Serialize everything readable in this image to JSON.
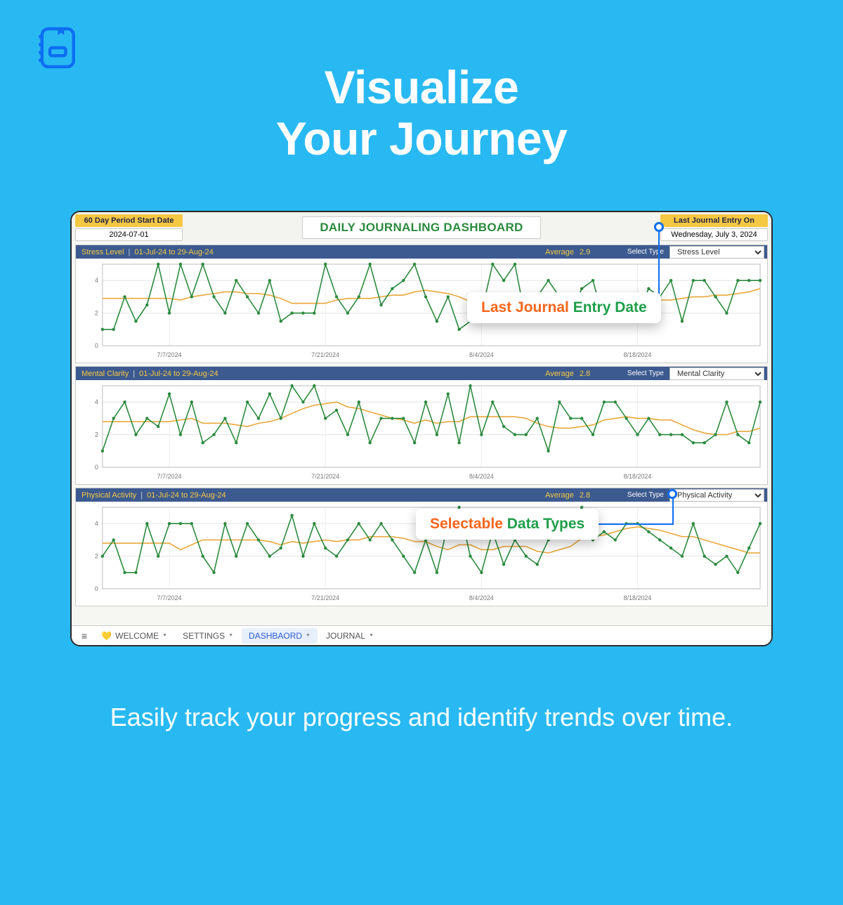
{
  "page": {
    "title_line1": "Visualize",
    "title_line2": "Your Journey",
    "subtitle": "Easily track your progress and identify trends over time."
  },
  "header": {
    "start_label": "60 Day Period Start Date",
    "start_value": "2024-07-01",
    "dash_title": "DAILY JOURNALING DASHBOARD",
    "last_label": "Last Journal Entry On",
    "last_value": "Wednesday, July 3, 2024"
  },
  "charts": [
    {
      "name": "Stress Level",
      "range": "01-Jul-24  to  29-Aug-24",
      "avg": "2.9",
      "type_selected": "Stress Level"
    },
    {
      "name": "Mental Clarity",
      "range": "01-Jul-24  to  29-Aug-24",
      "avg": "2.8",
      "type_selected": "Mental Clarity"
    },
    {
      "name": "Physical Activity",
      "range": "01-Jul-24  to  29-Aug-24",
      "avg": "2.8",
      "type_selected": "Physical Activity"
    }
  ],
  "common": {
    "avg_label": "Average",
    "select_label": "Select Type"
  },
  "x_ticks": [
    "7/7/2024",
    "7/21/2024",
    "8/4/2024",
    "8/18/2024"
  ],
  "y_ticks": [
    0,
    2,
    4
  ],
  "tabs": {
    "welcome": "WELCOME",
    "settings": "SETTINGS",
    "dashboard": "DASHBAORD",
    "journal": "JOURNAL"
  },
  "callouts": {
    "c1a": "Last Journal ",
    "c1b": "Entry Date",
    "c2a": "Selectable ",
    "c2b": "Data Types"
  },
  "chart_data": [
    {
      "type": "line",
      "title": "Stress Level  |  01-Jul-24 to 29-Aug-24   Average 2.9",
      "xlabel": "",
      "ylabel": "",
      "ylim": [
        0,
        5
      ],
      "x_tick_labels": [
        "7/7/2024",
        "7/21/2024",
        "8/4/2024",
        "8/18/2024"
      ],
      "series": [
        {
          "name": "Stress Level",
          "values": [
            1,
            1,
            3,
            1.5,
            2.5,
            5,
            2,
            5,
            3,
            5,
            3,
            2,
            4,
            3,
            2,
            4,
            1.5,
            2,
            2,
            2,
            5,
            3,
            2,
            3,
            5,
            2.5,
            3.5,
            4,
            5,
            3,
            1.5,
            3,
            1,
            1.5,
            2,
            5,
            4,
            5,
            1.5,
            3,
            4,
            3,
            2,
            3.5,
            4,
            1.5,
            2.5,
            3,
            2,
            3.5,
            3,
            4,
            1.5,
            4,
            4,
            3,
            2,
            4,
            4,
            4
          ]
        },
        {
          "name": "7-day Avg",
          "values": [
            2.9,
            2.9,
            2.9,
            2.9,
            2.9,
            2.9,
            2.9,
            2.8,
            3.0,
            3.1,
            3.2,
            3.3,
            3.3,
            3.2,
            3.2,
            3.1,
            2.9,
            2.6,
            2.6,
            2.6,
            2.6,
            2.8,
            2.9,
            2.9,
            2.9,
            3.0,
            3.1,
            3.1,
            3.3,
            3.4,
            3.3,
            3.2,
            3.0,
            2.7,
            2.4,
            2.5,
            2.6,
            2.9,
            3.0,
            3.0,
            3.0,
            3.1,
            3.0,
            2.9,
            2.8,
            2.9,
            2.9,
            2.8,
            2.8,
            2.8,
            2.8,
            2.8,
            2.9,
            3.0,
            3.0,
            3.1,
            3.1,
            3.2,
            3.3,
            3.5
          ]
        }
      ]
    },
    {
      "type": "line",
      "title": "Mental Clarity  |  01-Jul-24 to 29-Aug-24   Average 2.8",
      "xlabel": "",
      "ylabel": "",
      "ylim": [
        0,
        5
      ],
      "x_tick_labels": [
        "7/7/2024",
        "7/21/2024",
        "8/4/2024",
        "8/18/2024"
      ],
      "series": [
        {
          "name": "Mental Clarity",
          "values": [
            1,
            3,
            4,
            2,
            3,
            2.5,
            4.5,
            2,
            4,
            1.5,
            2,
            3,
            1.5,
            4,
            3,
            4.5,
            3,
            5,
            4,
            5,
            3,
            3.5,
            2,
            4,
            1.5,
            3,
            3,
            3,
            1.5,
            4,
            2,
            4.5,
            1.5,
            5,
            2,
            4,
            2.5,
            2,
            2,
            3,
            1,
            4,
            3,
            3,
            2,
            4,
            4,
            3,
            2,
            3,
            2,
            2,
            2,
            1.5,
            1.5,
            2,
            4,
            2,
            1.5,
            4
          ]
        },
        {
          "name": "7-day Avg",
          "values": [
            2.8,
            2.8,
            2.8,
            2.8,
            2.8,
            2.8,
            2.8,
            2.9,
            3.0,
            2.7,
            2.7,
            2.7,
            2.6,
            2.5,
            2.7,
            2.8,
            3.0,
            3.3,
            3.6,
            3.8,
            3.9,
            4.0,
            3.7,
            3.6,
            3.4,
            3.2,
            3.0,
            2.9,
            2.7,
            2.9,
            2.7,
            2.8,
            2.8,
            3.1,
            3.1,
            3.1,
            3.1,
            3.1,
            3.0,
            2.7,
            2.5,
            2.4,
            2.4,
            2.5,
            2.6,
            2.9,
            3.0,
            3.1,
            3.0,
            3.0,
            2.9,
            2.9,
            2.6,
            2.3,
            2.1,
            2.0,
            2.0,
            2.2,
            2.2,
            2.4
          ]
        }
      ]
    },
    {
      "type": "line",
      "title": "Physical Activity  |  01-Jul-24 to 29-Aug-24   Average 2.8",
      "xlabel": "",
      "ylabel": "",
      "ylim": [
        0,
        5
      ],
      "x_tick_labels": [
        "7/7/2024",
        "7/21/2024",
        "8/4/2024",
        "8/18/2024"
      ],
      "series": [
        {
          "name": "Physical Activity",
          "values": [
            2,
            3,
            1,
            1,
            4,
            2,
            4,
            4,
            4,
            2,
            1,
            4,
            2,
            4,
            3,
            2,
            2.5,
            4.5,
            2,
            4,
            2.5,
            2,
            3,
            4,
            3,
            4,
            3,
            2,
            1,
            3,
            1,
            4,
            5,
            2,
            1,
            3.5,
            1.5,
            3,
            2,
            1.5,
            3,
            3.5,
            4,
            5,
            3,
            3.5,
            3,
            4,
            4,
            3.5,
            3,
            2.5,
            2,
            4,
            2,
            1.5,
            2,
            1,
            2.5,
            4
          ]
        },
        {
          "name": "7-day Avg",
          "values": [
            2.8,
            2.8,
            2.8,
            2.8,
            2.8,
            2.8,
            2.8,
            2.4,
            2.7,
            3.0,
            3.0,
            3.0,
            3.0,
            3.0,
            3.0,
            2.9,
            2.7,
            2.9,
            2.8,
            2.9,
            3.0,
            2.9,
            3.0,
            3.0,
            3.2,
            3.2,
            3.2,
            3.1,
            2.9,
            2.9,
            2.6,
            2.4,
            2.7,
            2.7,
            2.4,
            2.4,
            2.6,
            2.6,
            2.6,
            2.3,
            2.2,
            2.4,
            2.6,
            3.1,
            3.2,
            3.3,
            3.5,
            3.7,
            3.8,
            3.7,
            3.6,
            3.4,
            3.2,
            3.2,
            3.0,
            2.8,
            2.6,
            2.4,
            2.2,
            2.2
          ]
        }
      ]
    }
  ]
}
